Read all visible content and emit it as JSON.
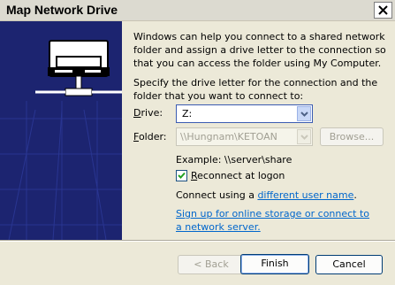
{
  "window": {
    "title": "Map Network Drive",
    "close_icon": "close-icon"
  },
  "intro": "Windows can help you connect to a shared network folder and assign a drive letter to the connection so that you can access the folder using My Computer.",
  "specify": "Specify the drive letter for the connection and the folder that you want to connect to:",
  "drive": {
    "label_accel": "D",
    "label_rest": "rive:",
    "value": "Z:"
  },
  "folder": {
    "label_accel": "F",
    "label_rest": "older:",
    "value": "\\\\Hungnam\\KETOAN"
  },
  "browse_label": "Browse...",
  "example": "Example: \\\\server\\share",
  "reconnect": {
    "accel": "R",
    "rest": "econnect at logon",
    "checked": true
  },
  "connect_using": {
    "prefix": "Connect using a ",
    "link": "different user name",
    "suffix": "."
  },
  "signup_link": "Sign up for online storage or connect to a network server.",
  "buttons": {
    "back": "< Back",
    "finish": "Finish",
    "cancel": "Cancel"
  },
  "colors": {
    "side_panel": "#1c2470",
    "link": "#0066cc",
    "dialog": "#ece9d8"
  }
}
